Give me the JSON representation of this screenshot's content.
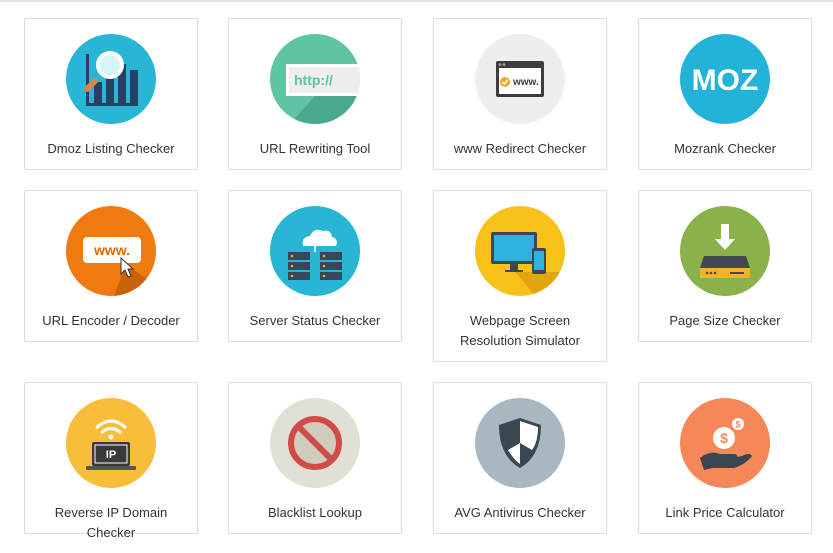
{
  "tools": [
    {
      "label": "Dmoz Listing Checker",
      "icon": "bar-chart-magnifier-icon",
      "color": "#29b6d6"
    },
    {
      "label": "URL Rewriting Tool",
      "icon": "http-url-icon",
      "color": "#5fc3a6"
    },
    {
      "label": "www Redirect Checker",
      "icon": "browser-window-www-icon",
      "color": "#efeeed"
    },
    {
      "label": "Mozrank Checker",
      "icon": "moz-logo-icon",
      "color": "#23b3d8"
    },
    {
      "label": "URL Encoder / Decoder",
      "icon": "www-cursor-icon",
      "color": "#f07a10"
    },
    {
      "label": "Server Status Checker",
      "icon": "cloud-server-icon",
      "color": "#29b6d6"
    },
    {
      "label": "Webpage Screen Resolution Simulator",
      "icon": "monitor-phone-icon",
      "color": "#f7c11a"
    },
    {
      "label": "Page Size Checker",
      "icon": "download-drive-icon",
      "color": "#8bb14a"
    },
    {
      "label": "Reverse IP Domain Checker",
      "icon": "laptop-wifi-ip-icon",
      "color": "#f8bd3a"
    },
    {
      "label": "Blacklist Lookup",
      "icon": "prohibited-sign-icon",
      "color": "#e2e0d4"
    },
    {
      "label": "AVG Antivirus Checker",
      "icon": "shield-icon",
      "color": "#a8b7c0"
    },
    {
      "label": "Link Price Calculator",
      "icon": "hand-coin-dollar-icon",
      "color": "#f58758"
    }
  ],
  "icon_text": {
    "http": "http://",
    "www": "www.",
    "moz": "MOZ",
    "www_encoder": "www.",
    "ip": "IP"
  }
}
